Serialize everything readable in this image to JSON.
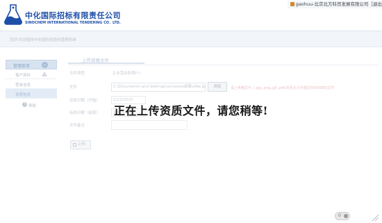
{
  "header": {
    "company_cn": "中化国际招标有限责任公司",
    "company_en": "SINOCHEM INTERNATIONAL TENDERING CO．LTD.",
    "user_info": "gaohuu-北京北方科贸发展有限公司［退出"
  },
  "subnav": {
    "text": "您好!欢迎使用中化国际招投标管理系统"
  },
  "sidebar": {
    "header_label": "管理菜单",
    "items": [
      {
        "label": "客户资料"
      },
      {
        "label": "登录信息"
      },
      {
        "label": "资质信息"
      },
      {
        "label": "帮助"
      }
    ]
  },
  "main": {
    "tab_label": "上传资格文件",
    "fields": {
      "file_type_label": "文件类型",
      "file_type_value": "企业营业执照(*)",
      "file_label": "文件",
      "file_value": "C:\\Documents and Settings\\sunsoea\\桌面\\zlbe.jpg",
      "browse_label": "浏览",
      "file_hint": "请上传格式为（.jpg,.png,.gif,.pdf)并且大小不超过5000KB的文件",
      "issue_date_label": "有效日期（开始）",
      "issue_date_value": "11/2/2010",
      "expire_date_label": "有效日期（结束）",
      "expire_date_value": "10/31/2015",
      "remark_label": "文件备注",
      "remark_value": ""
    },
    "upload_button": "上传"
  },
  "overlay": {
    "message": "正在上传资质文件，请您稍等!"
  },
  "corner_button": {
    "label": "0"
  }
}
